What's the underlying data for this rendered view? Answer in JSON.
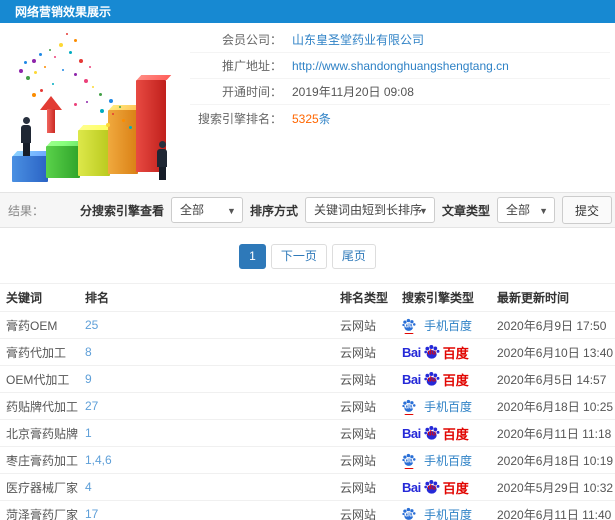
{
  "header": {
    "title": "网络营销效果展示"
  },
  "info": {
    "rows": [
      {
        "label": "会员公司：",
        "value": "山东皇圣堂药业有限公司",
        "type": "link"
      },
      {
        "label": "推广地址：",
        "value": "http://www.shandonghuangshengtang.cn",
        "type": "link"
      },
      {
        "label": "开通时间：",
        "value": "2019年11月20日 09:08",
        "type": "text"
      },
      {
        "label": "搜索引擎排名：",
        "value": "5325",
        "suffix": "条",
        "type": "highlight"
      }
    ]
  },
  "filters": {
    "result_label": "结果：",
    "engine_label": "分搜索引擎查看",
    "engine_value": "全部",
    "sort_label": "排序方式",
    "sort_value": "关键词由短到长排序",
    "article_label": "文章类型",
    "article_value": "全部",
    "submit_label": "提交",
    "caret": "▼"
  },
  "pagination": {
    "current": "1",
    "next_label": "下一页",
    "last_label": "尾页"
  },
  "engines": {
    "baidu": {
      "prefix": "Bai",
      "du": "du",
      "suffix": "百度"
    },
    "mobile": {
      "du": "du",
      "label": "手机百度"
    }
  },
  "table": {
    "headers": [
      "关键词",
      "排名",
      "排名类型",
      "搜索引擎类型",
      "最新更新时间"
    ],
    "rows": [
      {
        "keyword": "膏药OEM",
        "rank": "25",
        "rank_type": "云网站",
        "engine": "mobile",
        "time": "2020年6月9日 17:50"
      },
      {
        "keyword": "膏药代加工",
        "rank": "8",
        "rank_type": "云网站",
        "engine": "baidu",
        "time": "2020年6月10日 13:40"
      },
      {
        "keyword": "OEM代加工",
        "rank": "9",
        "rank_type": "云网站",
        "engine": "baidu",
        "time": "2020年6月5日 14:57"
      },
      {
        "keyword": "药贴牌代加工",
        "rank": "27",
        "rank_type": "云网站",
        "engine": "mobile",
        "time": "2020年6月18日 10:25"
      },
      {
        "keyword": "北京膏药贴牌",
        "rank": "1",
        "rank_type": "云网站",
        "engine": "baidu",
        "time": "2020年6月11日 11:18"
      },
      {
        "keyword": "枣庄膏药加工",
        "rank": "1,4,6",
        "rank_type": "云网站",
        "engine": "mobile",
        "time": "2020年6月18日 10:19"
      },
      {
        "keyword": "医疗器械厂家",
        "rank": "4",
        "rank_type": "云网站",
        "engine": "baidu",
        "time": "2020年5月29日 10:32"
      },
      {
        "keyword": "菏泽膏药厂家",
        "rank": "17",
        "rank_type": "云网站",
        "engine": "mobile",
        "time": "2020年6月11日 11:40"
      }
    ]
  },
  "colors": {
    "topbar": "#1789d2",
    "link": "#2f82c6",
    "rank_link": "#5e9fd8",
    "highlight_orange": "#ff6600",
    "active_page": "#2e79b9",
    "baidu_blue": "#2529d8",
    "baidu_red": "#e10602"
  }
}
